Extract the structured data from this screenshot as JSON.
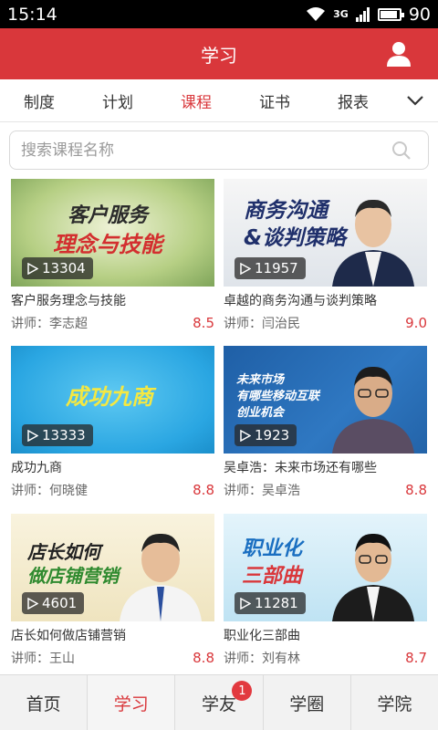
{
  "status": {
    "time": "15:14",
    "network": "3G",
    "battery": "90",
    "battery_level": 0.9
  },
  "header": {
    "title": "学习"
  },
  "tabs": [
    {
      "label": "制度"
    },
    {
      "label": "计划"
    },
    {
      "label": "课程",
      "active": true
    },
    {
      "label": "证书"
    },
    {
      "label": "报表"
    }
  ],
  "search": {
    "placeholder": "搜索课程名称"
  },
  "courses": [
    {
      "title": "客户服务理念与技能",
      "teacher": "讲师：李志超",
      "rating": "8.5",
      "plays": "13304",
      "cover_line1": "客户服务",
      "cover_line2": "理念与技能"
    },
    {
      "title": "卓越的商务沟通与谈判策略",
      "teacher": "讲师：闫治民",
      "rating": "9.0",
      "plays": "11957",
      "cover_line1": "商务沟通",
      "cover_line2": "&谈判策略"
    },
    {
      "title": "成功九商",
      "teacher": "讲师：何晓健",
      "rating": "8.8",
      "plays": "13333",
      "cover_line1": "成功九商",
      "cover_line2": ""
    },
    {
      "title": "吴卓浩：未来市场还有哪些",
      "teacher": "讲师：吴卓浩",
      "rating": "8.8",
      "plays": "1923",
      "cover_line1": "未来市场",
      "cover_line2": "有哪些移动互联",
      "cover_line3": "创业机会"
    },
    {
      "title": "店长如何做店铺营销",
      "teacher": "讲师：王山",
      "rating": "8.8",
      "plays": "4601",
      "cover_line1": "店长如何",
      "cover_line2": "做店铺营销"
    },
    {
      "title": "职业化三部曲",
      "teacher": "讲师：刘有林",
      "rating": "8.7",
      "plays": "11281",
      "cover_line1": "职业化",
      "cover_line2": "三部曲"
    }
  ],
  "bottom_nav": [
    {
      "label": "首页"
    },
    {
      "label": "学习",
      "active": true
    },
    {
      "label": "学友",
      "badge": "1"
    },
    {
      "label": "学圈"
    },
    {
      "label": "学院"
    }
  ],
  "colors": {
    "accent": "#d9373b"
  }
}
